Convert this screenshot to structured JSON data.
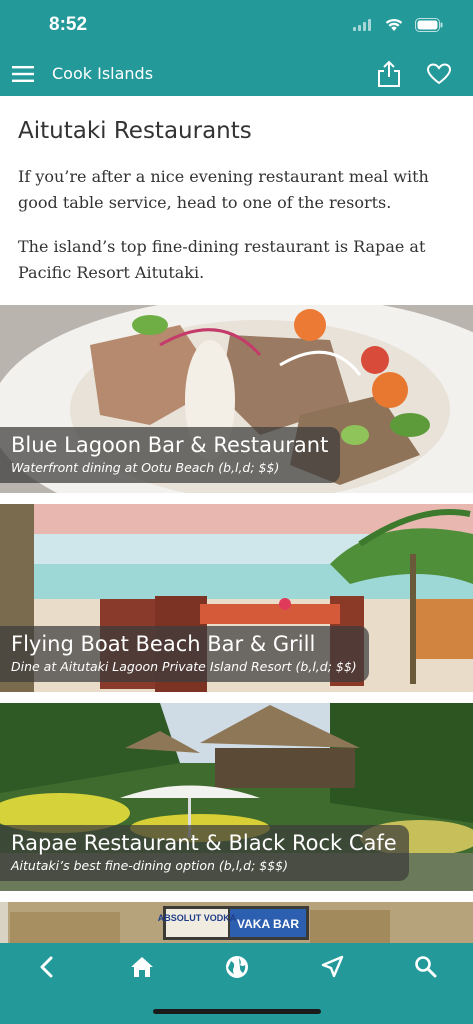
{
  "status_bar": {
    "time": "8:52"
  },
  "app_bar": {
    "title": "Cook Islands"
  },
  "page": {
    "heading": "Aitutaki Restaurants",
    "paragraphs": [
      "If you’re after a nice evening restaurant meal with good table service, head to one of the resorts.",
      "The island’s top fine-dining restaurant is Rapae at Pacific Resort Aitutaki."
    ]
  },
  "cards": [
    {
      "name": "Blue Lagoon Bar & Restaurant",
      "subtitle": "Waterfront dining at Ootu Beach (b,l,d; $$)"
    },
    {
      "name": "Flying Boat Beach Bar & Grill",
      "subtitle": "Dine at Aitutaki Lagoon Private Island Resort (b,l,d; $$)"
    },
    {
      "name": "Rapae Restaurant & Black Rock Cafe",
      "subtitle": "Aitutaki’s best fine-dining option (b,l,d; $$$)"
    },
    {
      "sign_top": "ABSOLUT VODKA",
      "sign_bottom": "VAKA BAR"
    }
  ],
  "colors": {
    "brand_teal": "#23999a",
    "text": "#333333"
  },
  "bottom_nav": {
    "items": [
      "back-icon",
      "home-icon",
      "globe-icon",
      "navigate-icon",
      "search-icon"
    ]
  }
}
